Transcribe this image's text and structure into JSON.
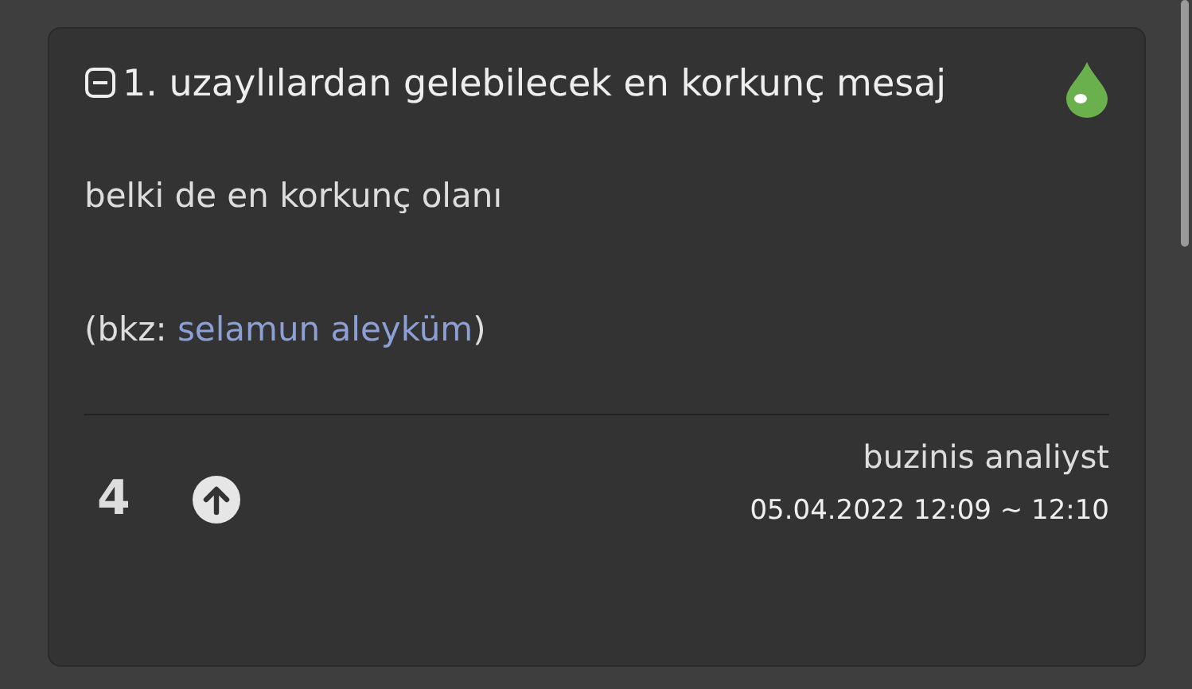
{
  "entry": {
    "title": "1. uzaylılardan gelebilecek en korkunç mesaj",
    "collapsed": false,
    "paragraphs": [
      {
        "text": "belki de en korkunç olanı"
      },
      {
        "prefix": "(bkz: ",
        "link": "selamun aleyküm",
        "suffix": ")"
      }
    ],
    "votes": "4",
    "author": "buzinis analiyst",
    "date": "05.04.2022 12:09 ~ 12:10"
  }
}
